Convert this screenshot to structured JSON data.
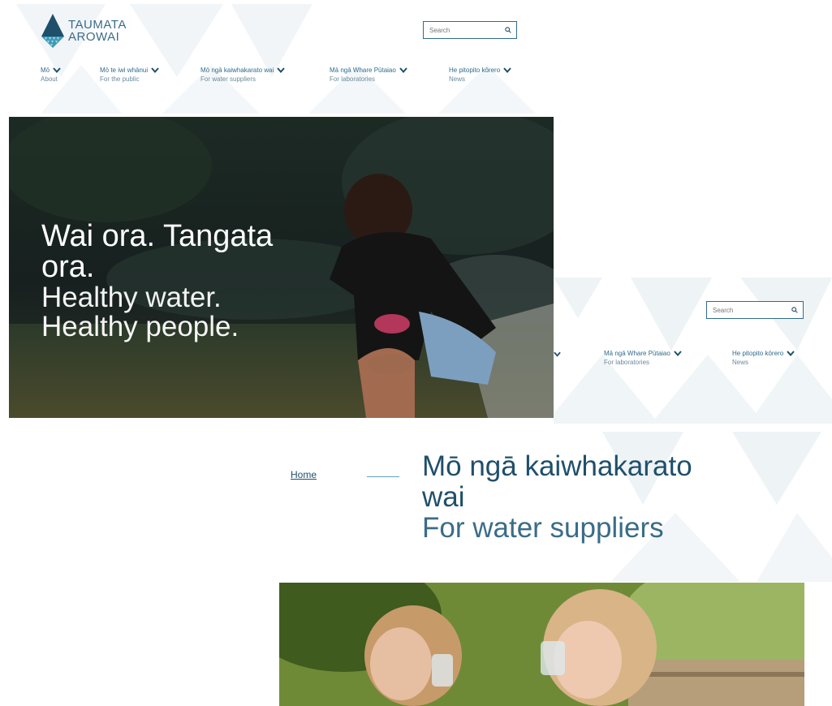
{
  "logo": {
    "line1": "TAUMATA",
    "line2": "AROWAI"
  },
  "search": {
    "placeholder": "Search"
  },
  "nav": [
    {
      "maori": "Mō",
      "english": "About"
    },
    {
      "maori": "Mō te iwi whānui",
      "english": "For the public"
    },
    {
      "maori": "Mō ngā kaiwhakarato wai",
      "english": "For water suppliers"
    },
    {
      "maori": "Mā ngā Whare Pūtaiao",
      "english": "For laboratories"
    },
    {
      "maori": "He pitopito kōrero",
      "english": "News"
    }
  ],
  "home_hero": {
    "maori": "Wai ora. Tangata ora.",
    "english_line1": "Healthy water.",
    "english_line2": "Healthy people."
  },
  "breadcrumb": {
    "home": "Home"
  },
  "supplier_page": {
    "title_maori": "Mō ngā kaiwhakarato wai",
    "title_english": "For water suppliers"
  },
  "colors": {
    "brand_navy": "#1f4f6b",
    "brand_teal": "#2f6b8d",
    "triangle_bg": "#eef3f6"
  }
}
